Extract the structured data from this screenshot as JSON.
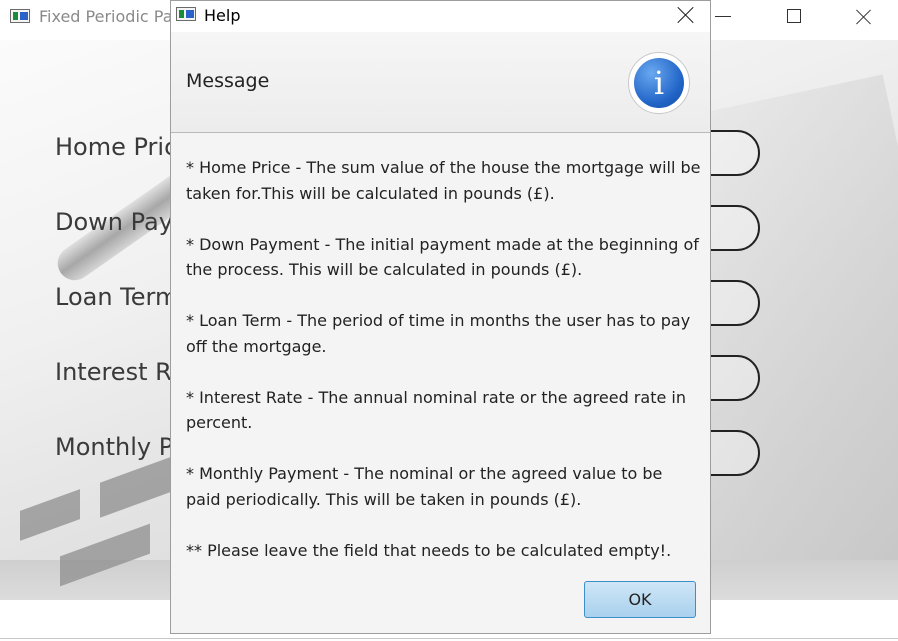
{
  "main_window": {
    "title": "Fixed Periodic Pa",
    "form_labels": [
      "Home Pric",
      "Down Payı",
      "Loan Term",
      "Interest Ra",
      "Monthly P"
    ]
  },
  "dialog": {
    "title": "Help",
    "header": "Message",
    "icon_glyph": "i",
    "icon_name": "info-icon",
    "paragraphs": [
      "* Home Price - The sum value of the house the mortgage will be taken for.This will be calculated in pounds (£).",
      " * Down Payment - The initial payment made at the beginning of the process. This will be calculated in pounds (£).",
      " * Loan Term - The period of time in months the user has to pay off the mortgage.",
      " * Interest Rate - The annual nominal rate or the agreed rate in percent.",
      " * Monthly Payment -  The nominal or the agreed value to be paid periodically. This will be taken in pounds (£).",
      " ** Please leave the field that needs to be calculated empty!."
    ],
    "ok_label": "OK"
  },
  "colors": {
    "accent": "#1f63c6",
    "ok_button": "#a9d1ee"
  }
}
